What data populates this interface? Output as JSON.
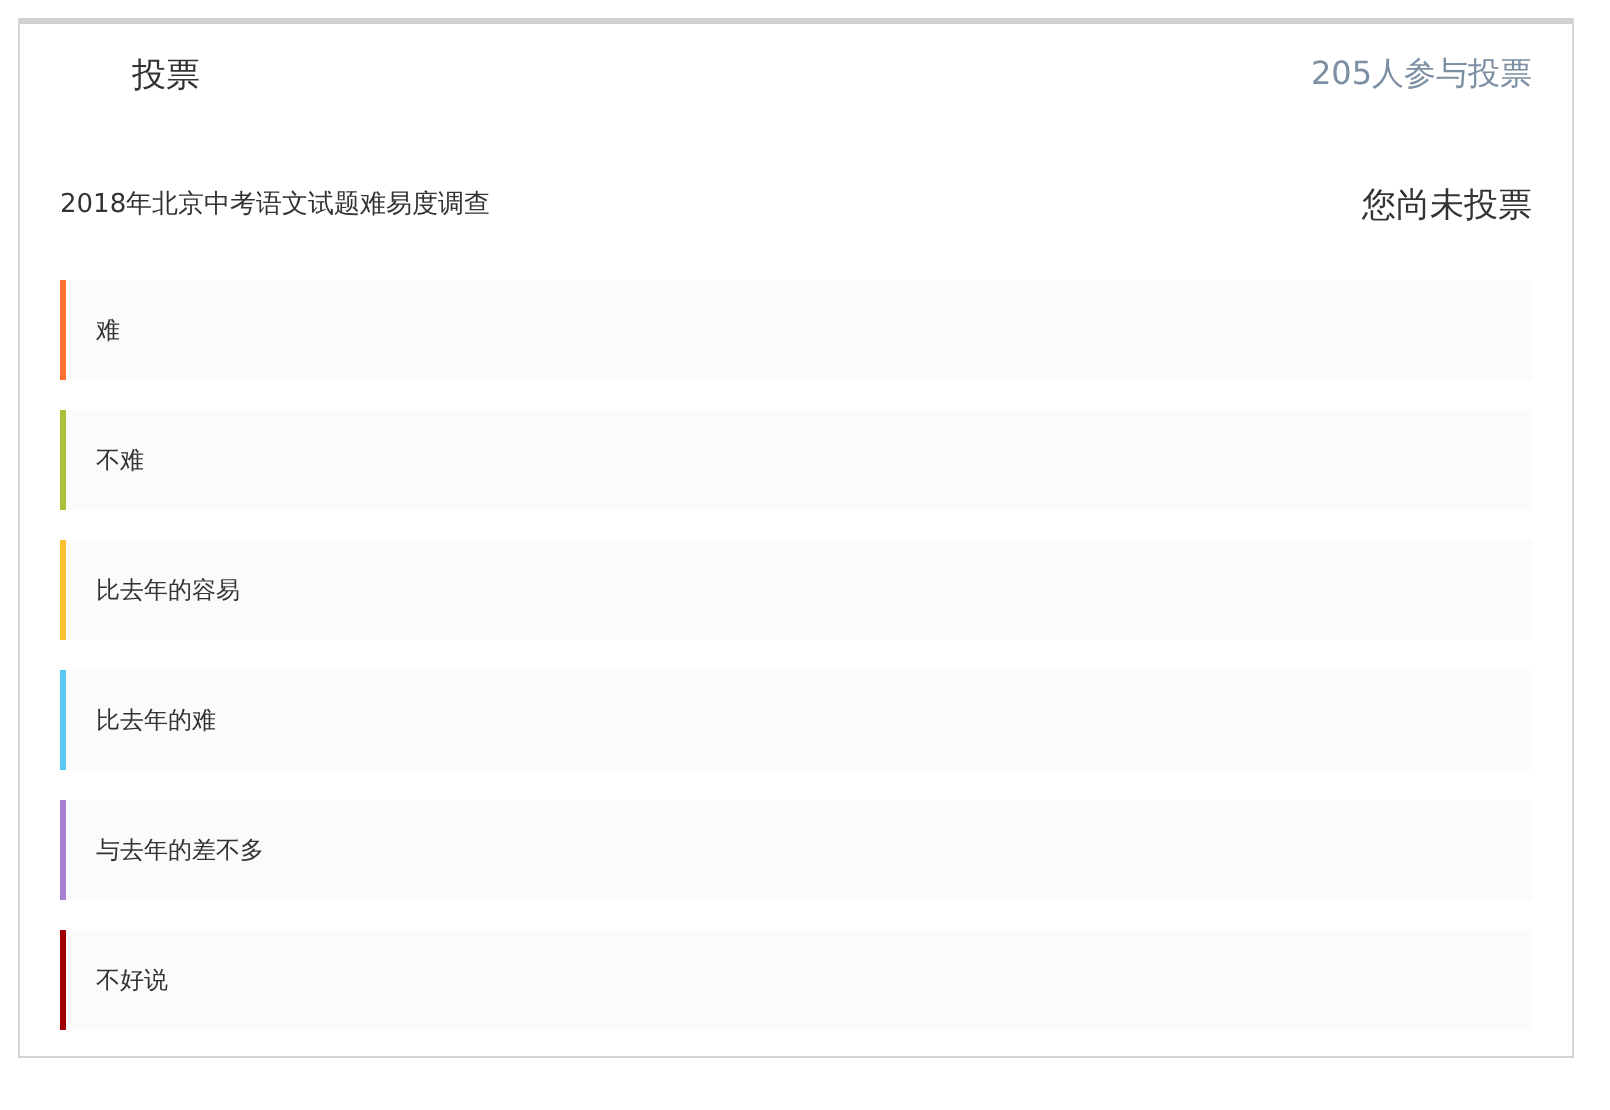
{
  "header": {
    "title": "投票",
    "participants": "205人参与投票"
  },
  "poll": {
    "question": "2018年北京中考语文试题难易度调查",
    "status": "您尚未投票"
  },
  "options": [
    {
      "label": "难",
      "color": "#ff7033"
    },
    {
      "label": "不难",
      "color": "#a8c33a"
    },
    {
      "label": "比去年的容易",
      "color": "#fcc02e"
    },
    {
      "label": "比去年的难",
      "color": "#5bc8f5"
    },
    {
      "label": "与去年的差不多",
      "color": "#a97fd6"
    },
    {
      "label": "不好说",
      "color": "#a10000"
    }
  ]
}
